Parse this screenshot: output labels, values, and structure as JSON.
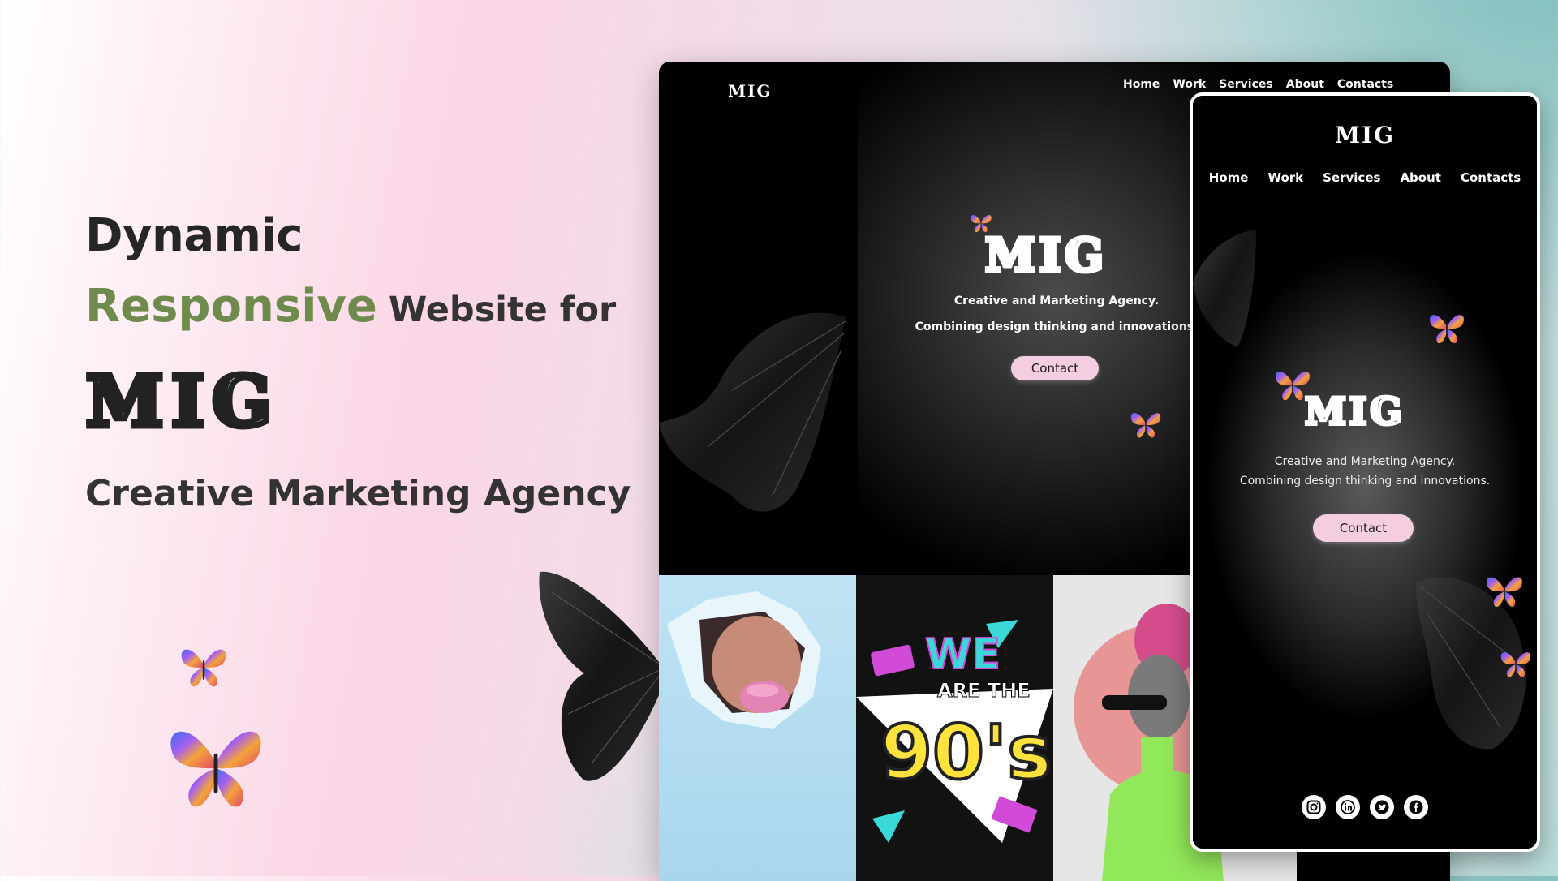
{
  "hero": {
    "line1": "Dynamic",
    "accent": "Responsive",
    "rest": "Website for",
    "logo": "MIG",
    "tagline": "Creative Marketing Agency"
  },
  "desktop": {
    "logo": "MIG",
    "nav": [
      "Home",
      "Work",
      "Services",
      "About",
      "Contacts"
    ],
    "title": "MIG",
    "subtitle1": "Creative and Marketing Agency.",
    "subtitle2": "Combining design thinking and innovations.",
    "button": "Contact",
    "tile2_text1": "WE",
    "tile2_text2": "ARE THE",
    "tile2_text3": "90's"
  },
  "mobile": {
    "logo": "MIG",
    "nav": [
      "Home",
      "Work",
      "Services",
      "About",
      "Contacts"
    ],
    "title": "MIG",
    "subtitle1": "Creative and Marketing Agency.",
    "subtitle2": "Combining design thinking and innovations.",
    "button": "Contact",
    "social": [
      "instagram-icon",
      "linkedin-icon",
      "twitter-icon",
      "facebook-icon"
    ]
  },
  "colors": {
    "accent_green": "#6e8a4c",
    "button_pink": "#f5cde0",
    "text_dark": "#262626"
  }
}
